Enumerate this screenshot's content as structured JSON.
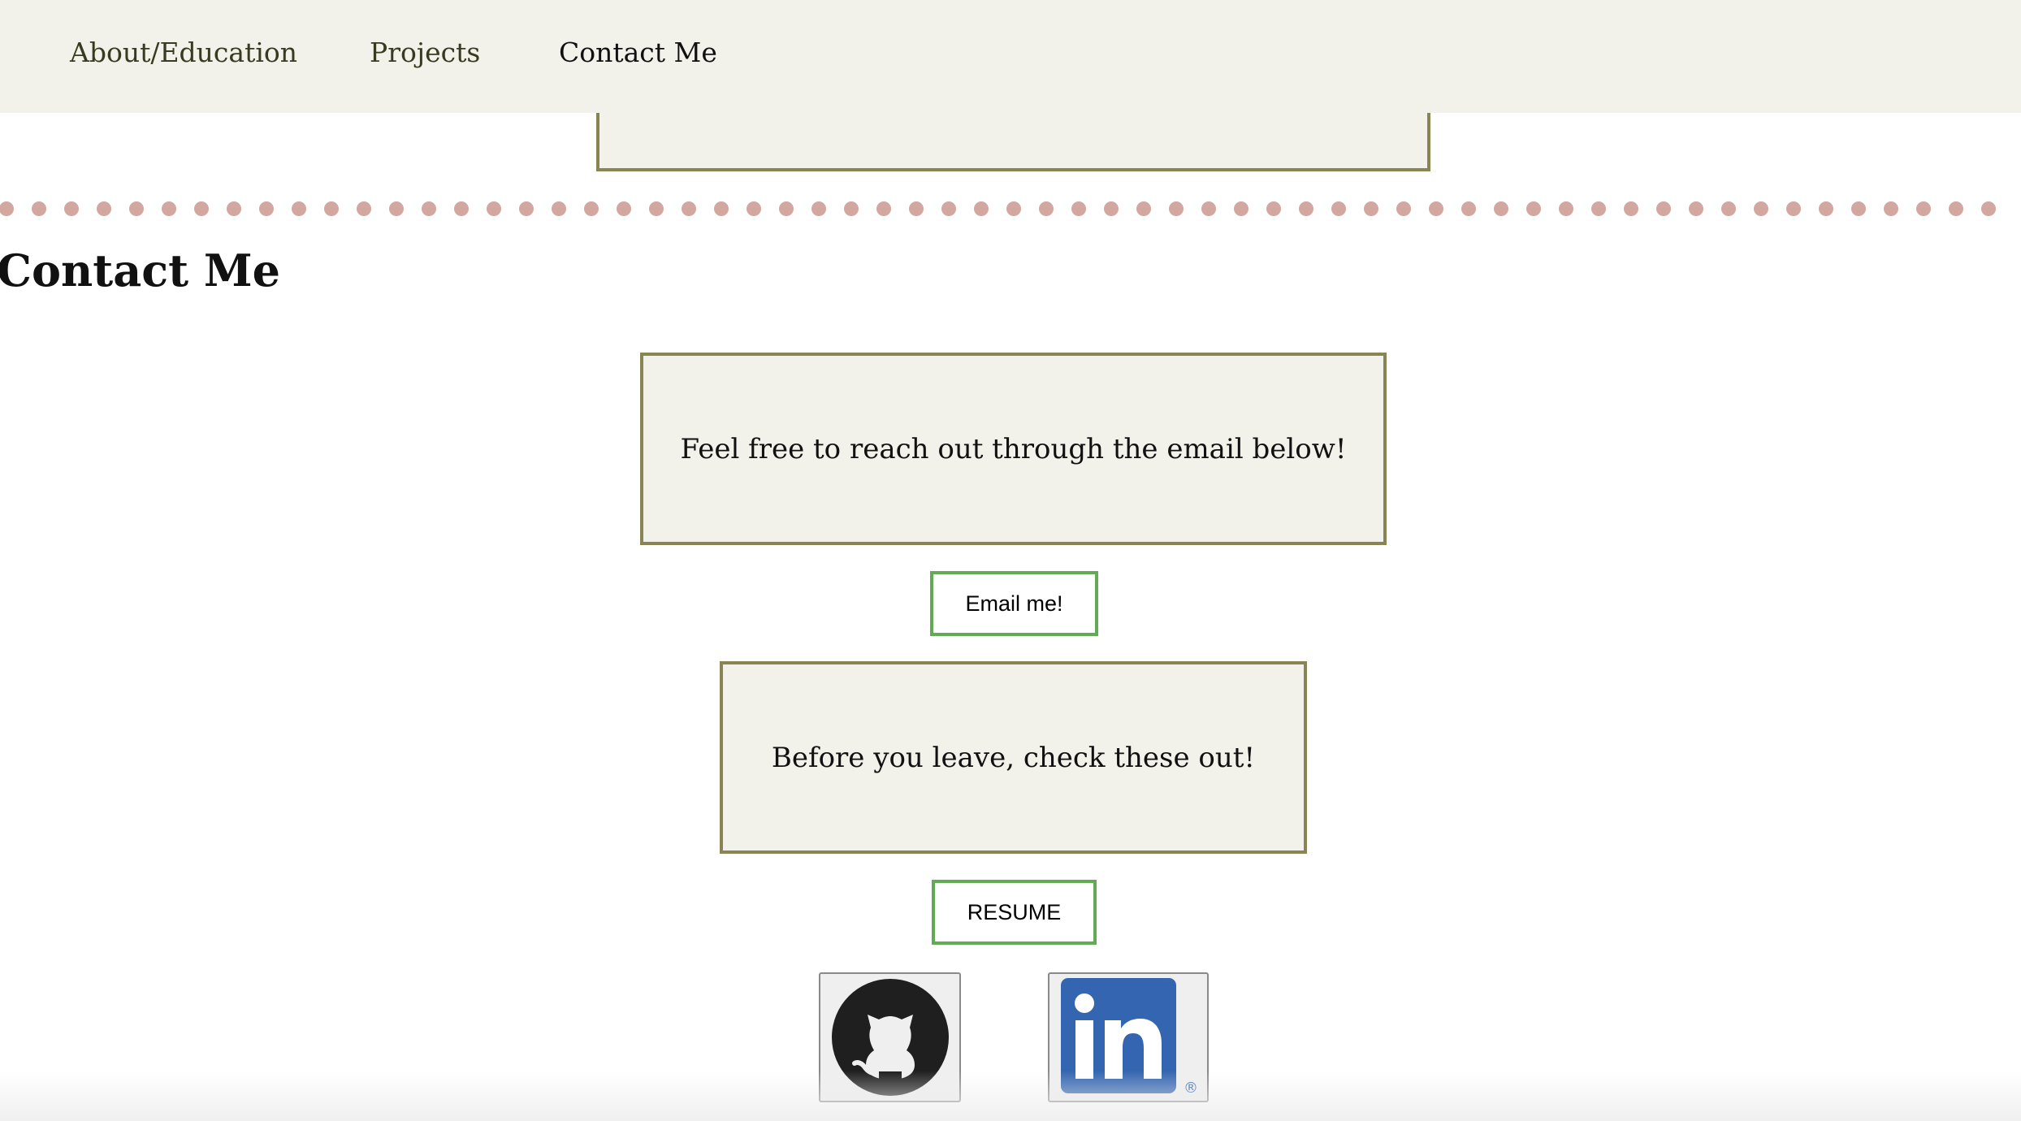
{
  "nav": {
    "items": [
      {
        "label": "About/Education"
      },
      {
        "label": "Projects"
      },
      {
        "label": "Contact Me"
      }
    ]
  },
  "section": {
    "title": "Contact Me"
  },
  "contact": {
    "email_prompt": "Feel free to reach out through the email below!",
    "email_button": "Email me!",
    "links_prompt": "Before you leave, check these out!",
    "resume_button": "RESUME"
  },
  "social": {
    "github_icon": "github-icon",
    "linkedin_icon": "linkedin-icon",
    "linkedin_letters": "in",
    "linkedin_mark": "®"
  },
  "colors": {
    "nav_background": "#f2f1ea",
    "box_border": "#888453",
    "box_background": "#f2f1ea",
    "button_border": "#63aa55",
    "divider_dots": "#d2a7a0",
    "linkedin_blue": "#3465b0"
  }
}
